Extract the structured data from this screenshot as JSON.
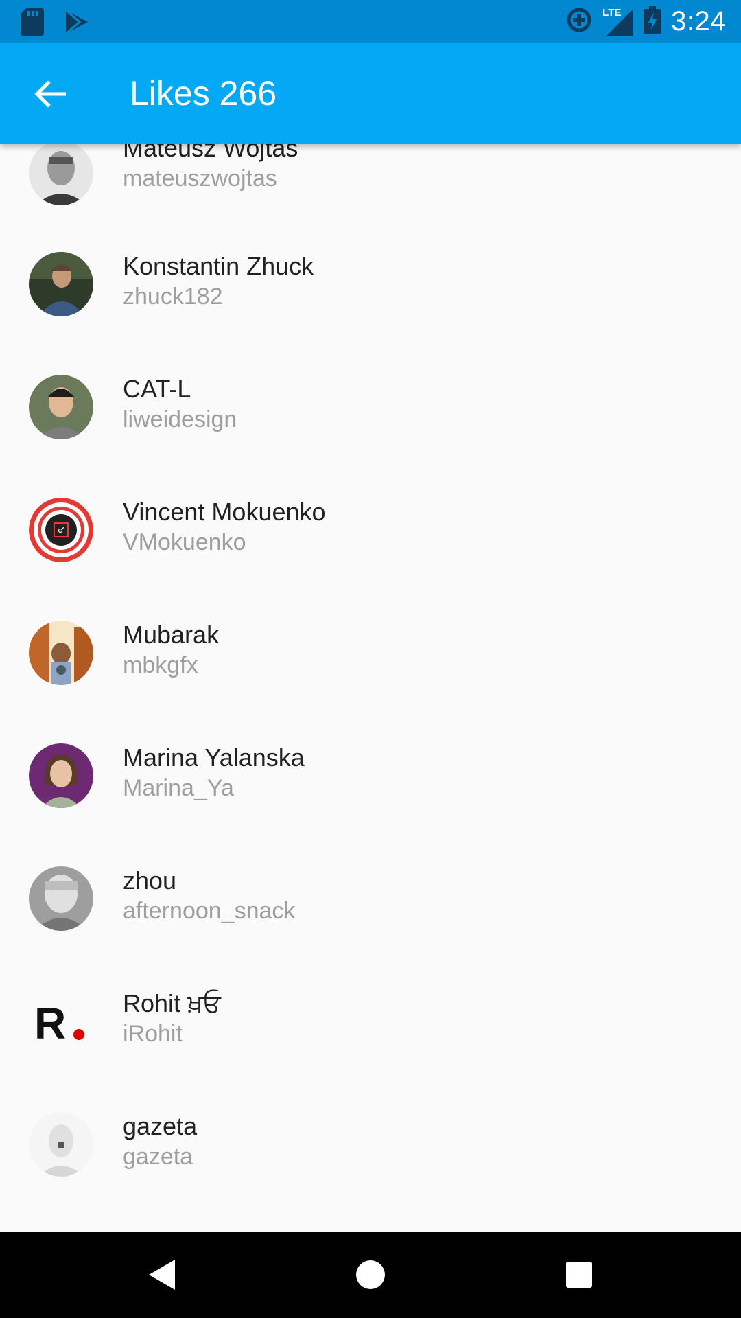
{
  "status_bar": {
    "time": "3:24",
    "network": "LTE",
    "icons_left": [
      "sd-card-icon",
      "play-store-icon"
    ],
    "icons_right": [
      "data-saver-icon",
      "lte-signal-icon",
      "battery-charging-icon"
    ]
  },
  "app_bar": {
    "title": "Likes 266",
    "back_icon": "arrow-left-icon",
    "color": "#03a9f4",
    "status_color": "#0288d1"
  },
  "likes": [
    {
      "name": "Mateusz Wojtas",
      "handle": "mateuszwojtas"
    },
    {
      "name": "Konstantin Zhuck",
      "handle": "zhuck182"
    },
    {
      "name": "CAT-L",
      "handle": "liweidesign"
    },
    {
      "name": "Vincent Mokuenko",
      "handle": "VMokuenko"
    },
    {
      "name": "Mubarak",
      "handle": "mbkgfx"
    },
    {
      "name": "Marina Yalanska",
      "handle": "Marina_Ya"
    },
    {
      "name": "zhou",
      "handle": "afternoon_snack"
    },
    {
      "name": "Rohit ਖ਼ਓ",
      "handle": "iRohit"
    },
    {
      "name": "gazeta",
      "handle": "gazeta"
    }
  ],
  "nav_bar": {
    "back_icon": "nav-back-icon",
    "home_icon": "nav-home-icon",
    "recents_icon": "nav-recents-icon"
  }
}
